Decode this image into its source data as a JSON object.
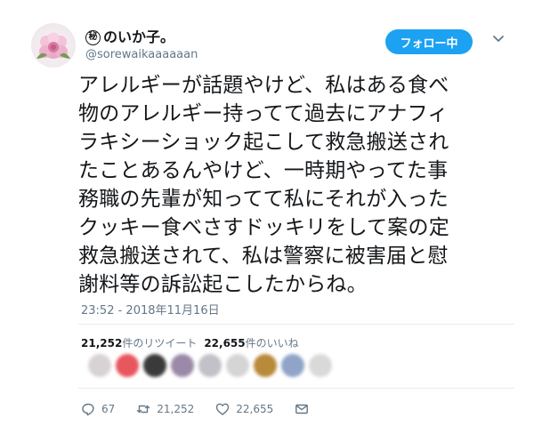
{
  "user": {
    "name_mark": "秘",
    "name_text": "のいか子。",
    "handle": "@sorewaikaaaaaan"
  },
  "follow_button_label": "フォロー中",
  "tweet": {
    "lines": [
      "アレルギーが話題やけど、私はある食べ",
      "物のアレルギー持ってて過去にアナフィ",
      "ラキシーショック起こして救急搬送され",
      "たことあるんやけど、一時期やってた事",
      "務職の先輩が知ってて私にそれが入った",
      "クッキー食べさすドッキリをして案の定",
      "救急搬送されて、私は警察に被害届と慰",
      "謝料等の訴訟起こしたからね。"
    ],
    "timestamp": "23:52 - 2018年11月16日"
  },
  "stats": {
    "retweets_count": "21,252",
    "retweets_label": "件のリツイート",
    "likes_count": "22,655",
    "likes_label": "件のいいね"
  },
  "likers": [
    "#d9d2d4",
    "#e8565e",
    "#3a3a3a",
    "#9a8aa8",
    "#c2c0c8",
    "#d5d5d5",
    "#b88a3a",
    "#8fa4c8",
    "#d9d9d9"
  ],
  "actions": {
    "reply_count": "67",
    "retweet_count": "21,252",
    "like_count": "22,655"
  },
  "icons": {
    "reply": "reply-icon",
    "retweet": "retweet-icon",
    "like": "heart-icon",
    "dm": "envelope-icon",
    "more": "chevron-down-icon"
  },
  "colors": {
    "accent": "#1da1f2",
    "secondary_text": "#657786",
    "primary_text": "#14171a"
  }
}
